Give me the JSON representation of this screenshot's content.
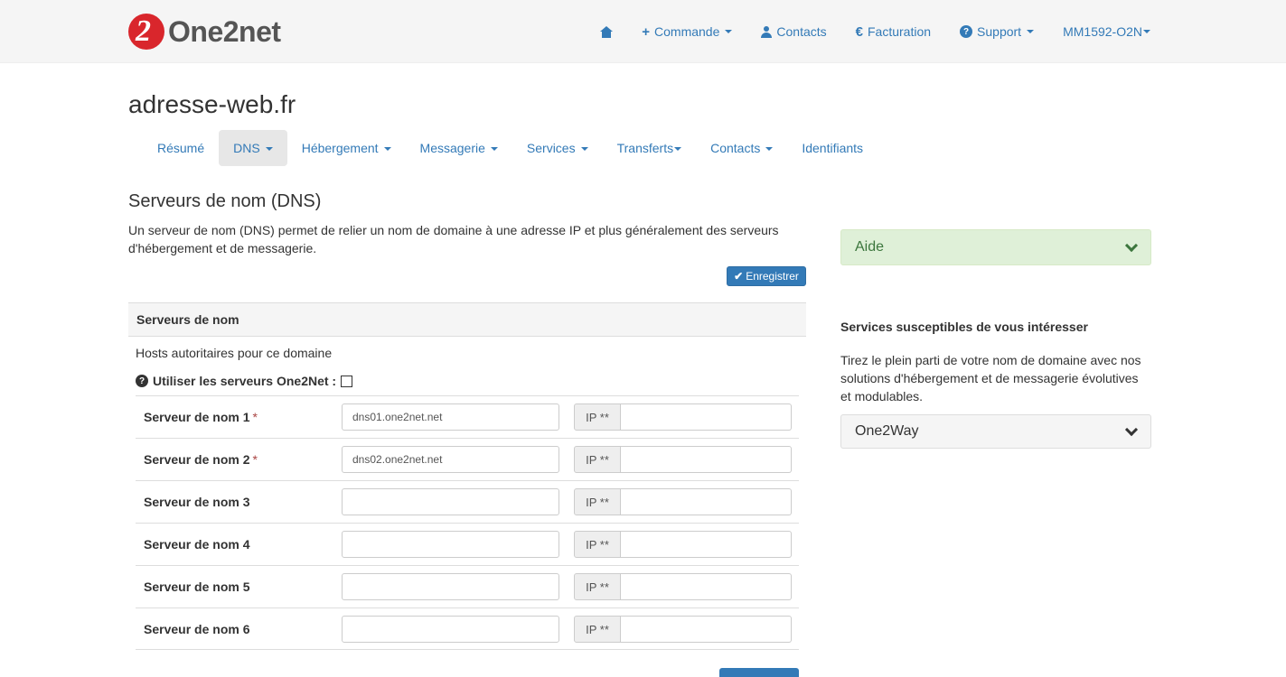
{
  "brand": {
    "logo_mark": "2",
    "name": "One2net",
    "logo_color": "#d9262c"
  },
  "topnav": {
    "home_icon": "home-icon",
    "commande": "Commande",
    "contacts": "Contacts",
    "facturation": "Facturation",
    "facturation_icon": "€",
    "support": "Support",
    "account": "MM1592-O2N"
  },
  "domain": "adresse-web.fr",
  "tabs": [
    {
      "label": "Résumé"
    },
    {
      "label": "DNS"
    },
    {
      "label": "Hébergement"
    },
    {
      "label": "Messagerie"
    },
    {
      "label": "Services"
    },
    {
      "label": "Transferts"
    },
    {
      "label": "Contacts"
    },
    {
      "label": "Identifiants"
    }
  ],
  "active_tab": "DNS",
  "section": {
    "title": "Serveurs de nom (DNS)",
    "intro": "Un serveur de nom (DNS) permet de relier un nom de domaine à une adresse IP et plus généralement des serveurs d'hébergement et de messagerie.",
    "save_label": "Enregistrer",
    "panel_title": "Serveurs de nom",
    "hosts_label": "Hosts autoritaires pour ce domaine",
    "use_one2net_label": "Utiliser les serveurs One2Net :",
    "use_one2net_checked": false,
    "ip_addon": "IP **",
    "required_mark": "*",
    "servers": [
      {
        "label": "Serveur de nom 1",
        "required": true,
        "value": "dns01.one2net.net",
        "ip": ""
      },
      {
        "label": "Serveur de nom 2",
        "required": true,
        "value": "dns02.one2net.net",
        "ip": ""
      },
      {
        "label": "Serveur de nom 3",
        "required": false,
        "value": "",
        "ip": ""
      },
      {
        "label": "Serveur de nom 4",
        "required": false,
        "value": "",
        "ip": ""
      },
      {
        "label": "Serveur de nom 5",
        "required": false,
        "value": "",
        "ip": ""
      },
      {
        "label": "Serveur de nom 6",
        "required": false,
        "value": "",
        "ip": ""
      }
    ]
  },
  "sidebar": {
    "aide_label": "Aide",
    "services_title": "Services susceptibles de vous intéresser",
    "services_text": "Tirez le plein parti de votre nom de domaine avec nos solutions d'hébergement et de messagerie évolutives et modulables.",
    "one2way_label": "One2Way"
  },
  "colors": {
    "link": "#337ab7",
    "aide_bg": "#dff0d8",
    "aide_text": "#3c763d",
    "primary_btn": "#337ab7"
  }
}
